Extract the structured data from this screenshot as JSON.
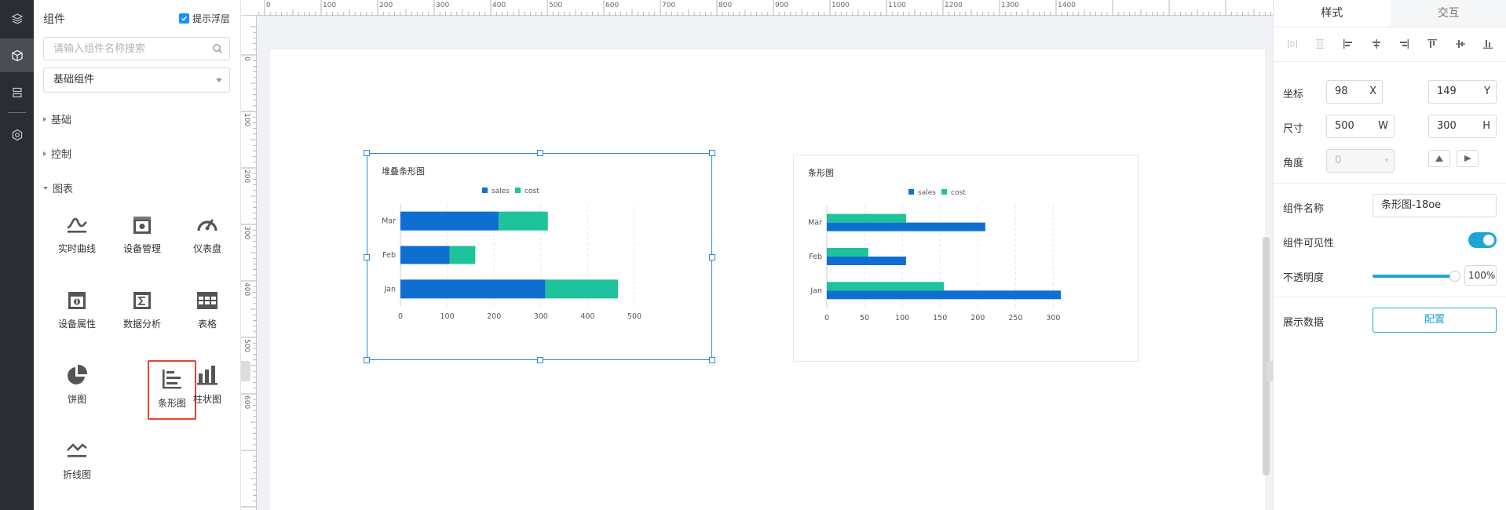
{
  "iconbar": {
    "items": [
      "layers-icon",
      "cube-icon",
      "storage-icon",
      "settings-icon"
    ]
  },
  "panel": {
    "title": "组件",
    "hint_label": "提示浮层",
    "hint_checked": true,
    "search_placeholder": "请输入组件名称搜索",
    "select_value": "基础组件",
    "categories": [
      "基础",
      "控制",
      "图表"
    ],
    "charts": [
      {
        "label": "实时曲线",
        "icon": "realtime-curve-icon"
      },
      {
        "label": "设备管理",
        "icon": "device-management-icon"
      },
      {
        "label": "仪表盘",
        "icon": "gauge-icon"
      },
      {
        "label": "设备属性",
        "icon": "device-property-icon"
      },
      {
        "label": "数据分析",
        "icon": "data-analysis-icon"
      },
      {
        "label": "表格",
        "icon": "table-icon"
      },
      {
        "label": "饼图",
        "icon": "pie-chart-icon"
      },
      {
        "label": "条形图",
        "icon": "bar-chart-icon"
      },
      {
        "label": "柱状图",
        "icon": "column-chart-icon"
      },
      {
        "label": "折线图",
        "icon": "line-chart-icon"
      }
    ]
  },
  "ruler": {
    "top": [
      "0",
      "100",
      "200",
      "300",
      "400",
      "500",
      "600",
      "700",
      "800",
      "900",
      "1000",
      "1100",
      "1200",
      "1300",
      "1400"
    ],
    "left": [
      "0",
      "100",
      "200",
      "300",
      "400",
      "500",
      "600"
    ]
  },
  "chart_data": [
    {
      "type": "bar",
      "orientation": "horizontal",
      "stacked": true,
      "title": "堆叠条形图",
      "categories": [
        "Jan",
        "Feb",
        "Mar"
      ],
      "series": [
        {
          "name": "sales",
          "color": "#0f6fd0",
          "values": [
            310,
            105,
            210
          ]
        },
        {
          "name": "cost",
          "color": "#1dc39a",
          "values": [
            155,
            55,
            105
          ]
        }
      ],
      "xlim": [
        0,
        500
      ],
      "xticks": [
        "0",
        "100",
        "200",
        "300",
        "400",
        "500"
      ],
      "legend": "top-center"
    },
    {
      "type": "bar",
      "orientation": "horizontal",
      "stacked": false,
      "title": "条形图",
      "categories": [
        "Jan",
        "Feb",
        "Mar"
      ],
      "series": [
        {
          "name": "sales",
          "color": "#0f6fd0",
          "values": [
            310,
            105,
            210
          ]
        },
        {
          "name": "cost",
          "color": "#1dc39a",
          "values": [
            155,
            55,
            105
          ]
        }
      ],
      "xlim": [
        0,
        310
      ],
      "xticks": [
        "0",
        "50",
        "100",
        "150",
        "200",
        "250",
        "300"
      ],
      "legend": "top-center"
    }
  ],
  "props": {
    "tabs": [
      "样式",
      "交互"
    ],
    "coord_label": "坐标",
    "x_value": "98",
    "x_unit": "X",
    "y_value": "149",
    "y_unit": "Y",
    "size_label": "尺寸",
    "w_value": "500",
    "w_unit": "W",
    "h_value": "300",
    "h_unit": "H",
    "angle_label": "角度",
    "angle_value": "0",
    "name_label": "组件名称",
    "name_value": "条形图-18oe",
    "visible_label": "组件可见性",
    "visible_on": true,
    "opacity_label": "不透明度",
    "opacity_value": "100%",
    "data_label": "展示数据",
    "config_button": "配置"
  },
  "colors": {
    "accent": "#1aa6d7",
    "selection": "#2f88d6",
    "highlight": "#e8442a"
  }
}
